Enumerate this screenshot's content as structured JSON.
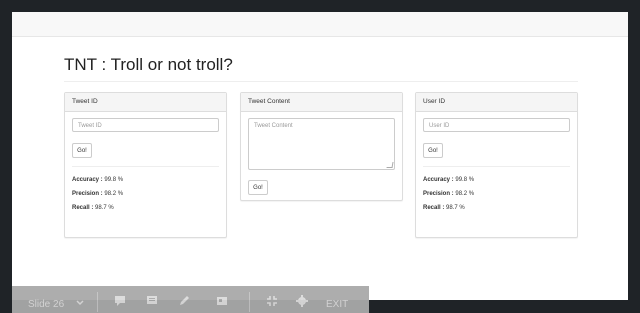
{
  "page": {
    "title": "TNT : Troll or not troll?"
  },
  "panels": [
    {
      "heading": "Tweet ID",
      "input_placeholder": "Tweet ID",
      "button_label": "Go!",
      "stats": [
        {
          "label": "Accuracy :",
          "value": "99.8 %"
        },
        {
          "label": "Precision :",
          "value": "98.2 %"
        },
        {
          "label": "Recall :",
          "value": "98.7 %"
        }
      ]
    },
    {
      "heading": "Tweet Content",
      "input_placeholder": "Tweet Content",
      "button_label": "Go!"
    },
    {
      "heading": "User ID",
      "input_placeholder": "User ID",
      "button_label": "Go!",
      "stats": [
        {
          "label": "Accuracy :",
          "value": "99.8 %"
        },
        {
          "label": "Precision :",
          "value": "98.2 %"
        },
        {
          "label": "Recall :",
          "value": "98.7 %"
        }
      ]
    }
  ],
  "toolbar": {
    "slide_label": "Slide 26",
    "exit_label": "EXIT",
    "icons": [
      "chevron-down-icon",
      "speaker-notes-icon",
      "comment-icon",
      "pen-icon",
      "slides-icon",
      "minimize-icon",
      "gear-icon"
    ]
  }
}
